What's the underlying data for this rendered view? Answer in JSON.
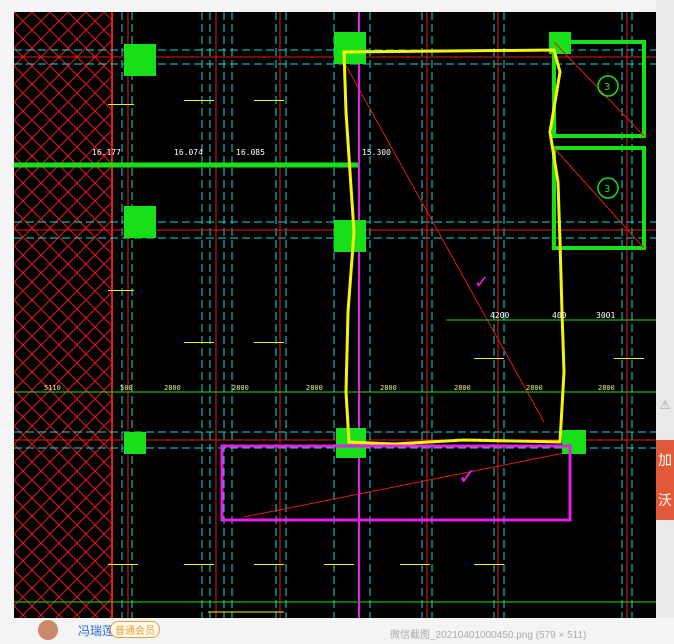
{
  "drawing": {
    "top_labels": [
      "16.074",
      "16.085",
      "15.300"
    ],
    "left_label": "16.177",
    "spacing_labels": [
      "5110",
      "500",
      "2800",
      "2800",
      "2800",
      "2800",
      "2800",
      "2800",
      "2800"
    ],
    "right_dims": [
      "4200",
      "400",
      "3001"
    ],
    "room_tags": [
      "3",
      "3"
    ]
  },
  "page": {
    "username": "冯瑞莲",
    "user_badge": "普通会员",
    "file_caption": "微信截图_20210401000450.png (579 × 511)",
    "side_banner_text": "加沃"
  },
  "colors": {
    "background": "#000000",
    "grid_cyan": "#18d6d6",
    "beam_red": "#e11b1b",
    "column_green": "#18e018",
    "highlight_yellow": "#f5f50a",
    "highlight_magenta": "#e81ee8"
  }
}
